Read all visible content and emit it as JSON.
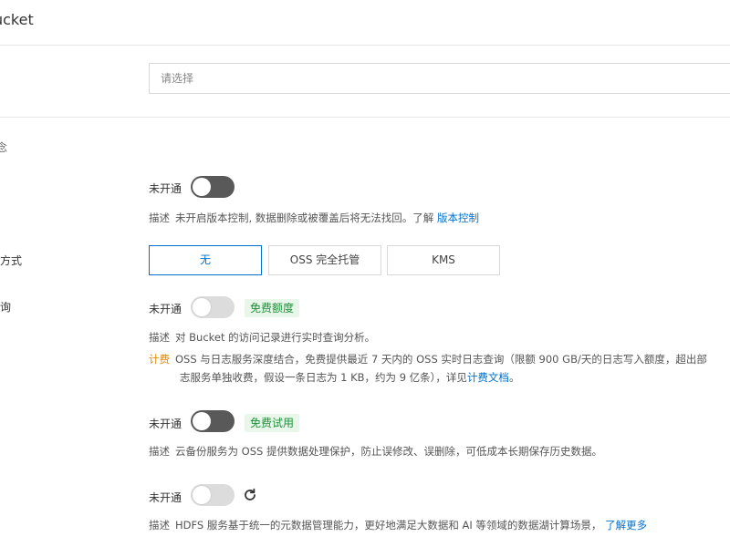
{
  "header": {
    "title": "Bucket"
  },
  "region": {
    "placeholder": "请选择"
  },
  "side_labels": {
    "encryption": "方式",
    "log_query": "询"
  },
  "versioning": {
    "status": "未开通",
    "desc_label": "描述",
    "desc_text": "未开启版本控制, 数据删除或被覆盖后将无法找回。了解",
    "link": "版本控制"
  },
  "encryption": {
    "options": [
      "无",
      "OSS 完全托管",
      "KMS"
    ],
    "selected": "无"
  },
  "realtime_log": {
    "status": "未开通",
    "badge": "免费额度",
    "desc_label": "描述",
    "desc_text": "对 Bucket 的访问记录进行实时查询分析。",
    "billing_label": "计费",
    "billing_line1": "OSS 与日志服务深度结合，免费提供最近 7 天内的 OSS 实时日志查询（限额 900 GB/天的日志写入额度，超出部",
    "billing_line2": "志服务单独收费，假设一条日志为 1 KB，约为 9 亿条），详见",
    "billing_link": "计费文档",
    "billing_end": "。"
  },
  "backup": {
    "status": "未开通",
    "badge": "免费试用",
    "desc_label": "描述",
    "desc_text": "云备份服务为 OSS 提供数据处理保护，防止误修改、误删除，可低成本长期保存历史数据。"
  },
  "hdfs": {
    "status": "未开通",
    "refresh_icon": "refresh-icon",
    "desc_label": "描述",
    "desc_text": "HDFS 服务基于统一的元数据管理能力，更好地满足大数据和 AI 等领域的数据湖计算场景，",
    "link": "了解更多"
  },
  "colors": {
    "link": "#0070cc",
    "badge_bg": "#e8f7ea",
    "badge_text": "#1f8f39",
    "billing_label": "#e08900"
  }
}
